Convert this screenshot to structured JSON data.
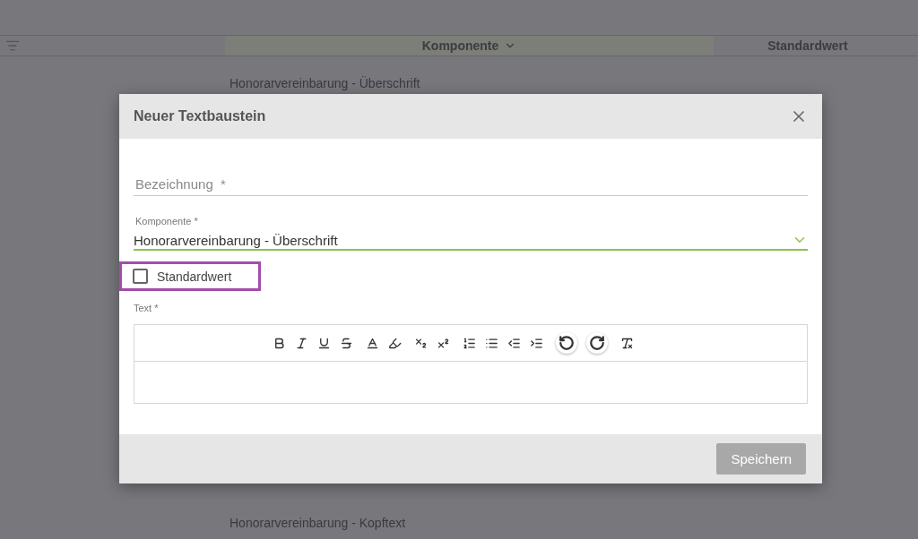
{
  "table": {
    "columns": [
      {
        "label": "Komponente",
        "sorted": true
      },
      {
        "label": "Standardwert",
        "sorted": false
      }
    ],
    "rows": [
      "Honorarvereinbarung - Überschrift",
      "Honorarvereinbarung - Kopftext"
    ]
  },
  "dialog": {
    "title": "Neuer Textbaustein",
    "name_field": {
      "placeholder": "Bezeichnung  *"
    },
    "component_field": {
      "label": "Komponente *",
      "value": "Honorarvereinbarung - Überschrift"
    },
    "default_checkbox": {
      "label": "Standardwert",
      "checked": false
    },
    "text_label": "Text *",
    "save_button": {
      "label": "Speichern",
      "disabled": true
    }
  }
}
